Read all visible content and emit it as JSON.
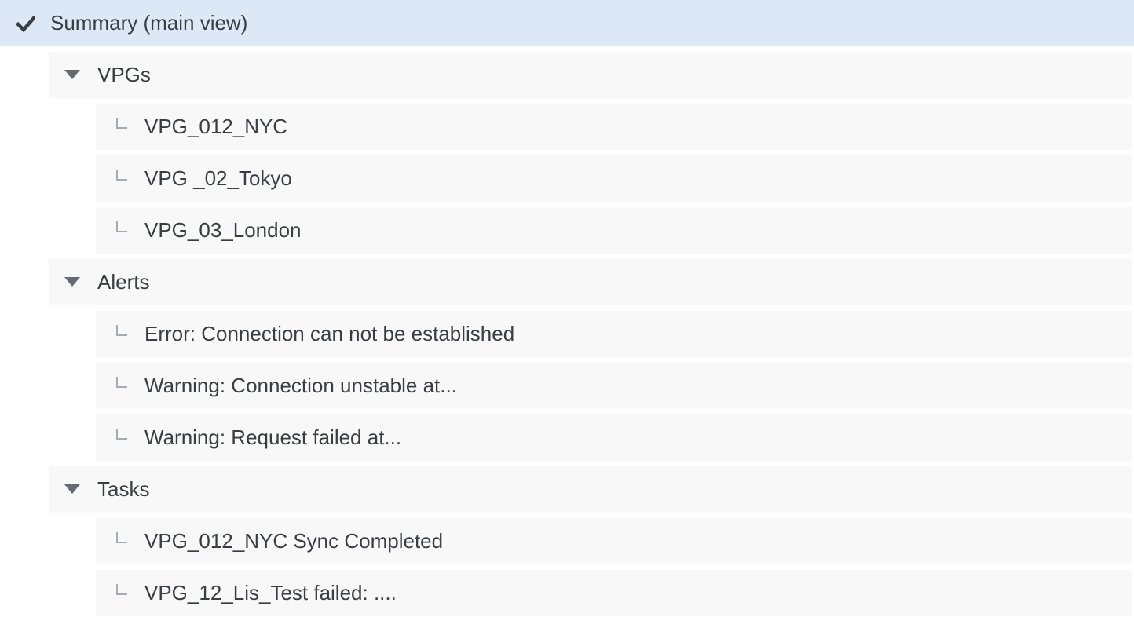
{
  "root": {
    "label": "Summary (main view)",
    "icon": "check-icon",
    "selected_bg": "#dce8f5"
  },
  "groups": [
    {
      "label": "VPGs",
      "icon": "caret-down-icon",
      "items": [
        {
          "label": "VPG_012_NYC"
        },
        {
          "label": "VPG _02_Tokyo"
        },
        {
          "label": "VPG_03_London"
        }
      ]
    },
    {
      "label": "Alerts",
      "icon": "caret-down-icon",
      "items": [
        {
          "label": "Error: Connection can not be established"
        },
        {
          "label": "Warning: Connection unstable at..."
        },
        {
          "label": "Warning: Request failed at..."
        }
      ]
    },
    {
      "label": "Tasks",
      "icon": "caret-down-icon",
      "items": [
        {
          "label": "VPG_012_NYC Sync Completed"
        },
        {
          "label": "VPG_12_Lis_Test failed: ...."
        }
      ]
    }
  ]
}
